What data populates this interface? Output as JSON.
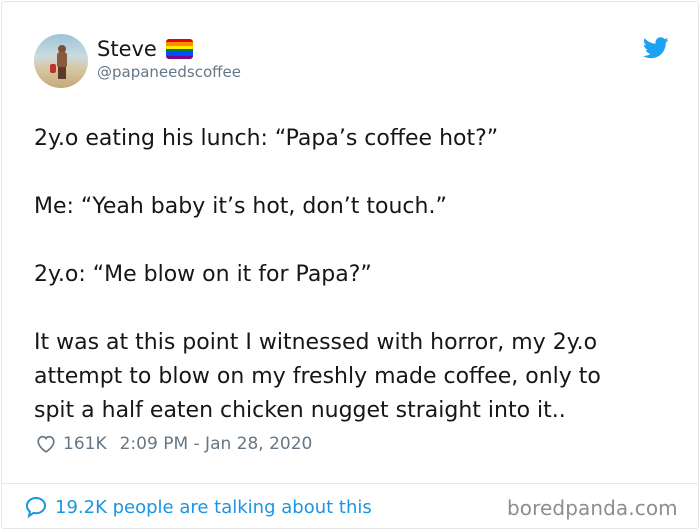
{
  "tweet": {
    "author": {
      "display_name": "Steve",
      "handle": "@papaneedscoffee",
      "badge": "rainbow-flag-emoji"
    },
    "body": [
      "2y.o eating his lunch: “Papa’s coffee hot?”",
      "Me: “Yeah baby it’s hot, don’t touch.”",
      "2y.o: “Me blow on it for Papa?”",
      "It was at this point I witnessed with horror, my 2y.o",
      "attempt to blow on my freshly made coffee, only to",
      "spit a half eaten chicken nugget straight into it.."
    ],
    "likes": "161K",
    "timestamp": "2:09 PM - Jan 28, 2020",
    "conversation_link": "19.2K people are talking about this"
  },
  "watermark": "boredpanda.com",
  "icons": {
    "logo": "twitter-bird-icon",
    "like": "heart-icon",
    "conversation": "speech-bubble-icon"
  },
  "colors": {
    "accent": "#1da1f2",
    "link": "#1b95e0",
    "secondary_text": "#657786",
    "primary_text": "#14171a",
    "border": "#e1e8ed",
    "flag": [
      "#e40303",
      "#ff8c00",
      "#ffed00",
      "#008026",
      "#004dff",
      "#750787"
    ]
  }
}
